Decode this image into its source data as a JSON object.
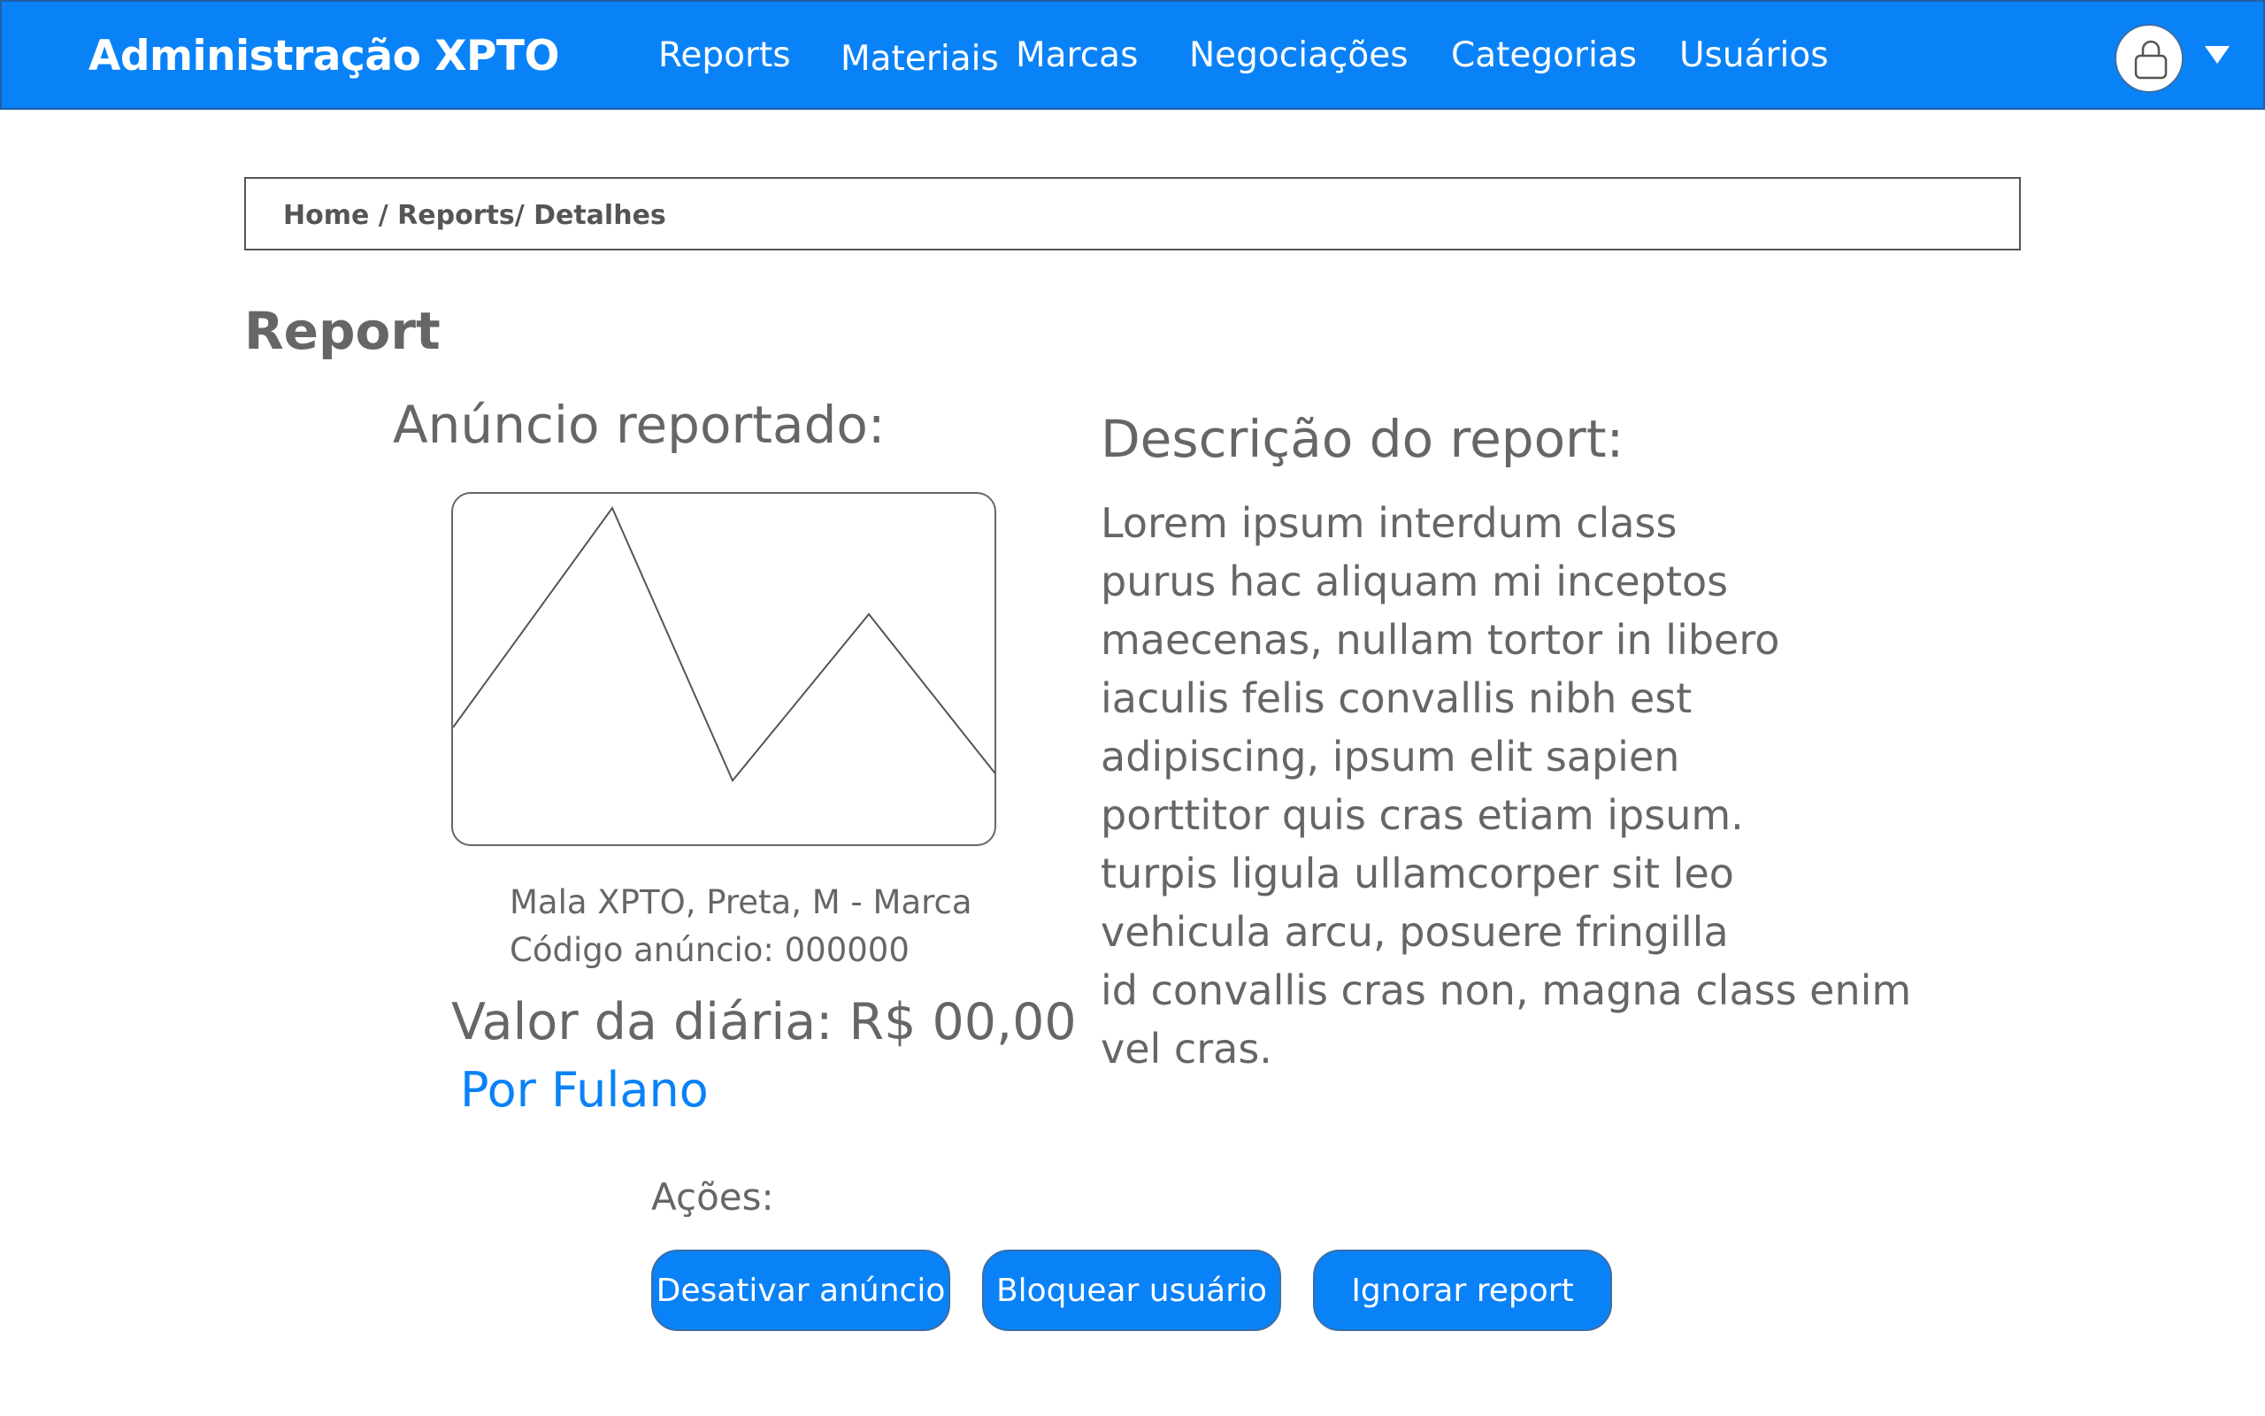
{
  "app": {
    "title": "Administração XPTO"
  },
  "nav": {
    "items": [
      "Reports",
      "Materiais",
      "Marcas",
      "Negociações",
      "Categorias",
      "Usuários"
    ]
  },
  "user_menu": {
    "avatar_icon": "user-lock-icon",
    "dropdown_icon": "caret-down-icon"
  },
  "breadcrumb": {
    "text": "Home / Reports/ Detalhes"
  },
  "page": {
    "title": "Report"
  },
  "ad": {
    "heading": "Anúncio reportado:",
    "image_icon": "image-placeholder-icon",
    "name": "Mala XPTO, Preta, M - Marca",
    "code": "Código anúncio: 000000",
    "price": "Valor da diária: R$ 00,00",
    "seller": "Por Fulano"
  },
  "report": {
    "heading": "Descrição do report:",
    "lines": [
      "Lorem ipsum interdum class",
      "purus hac aliquam mi inceptos",
      "maecenas, nullam tortor in libero",
      "iaculis felis convallis nibh est",
      "adipiscing, ipsum elit sapien",
      "porttitor quis cras etiam ipsum.",
      "turpis ligula ullamcorper sit leo",
      "vehicula arcu, posuere fringilla",
      "id convallis cras non, magna class enim",
      "vel cras."
    ]
  },
  "actions": {
    "label": "Ações:",
    "buttons": [
      "Desativar anúncio",
      "Bloquear usuário",
      "Ignorar report"
    ]
  },
  "colors": {
    "accent": "#0a82f7",
    "text": "#666666",
    "border": "#555555"
  }
}
